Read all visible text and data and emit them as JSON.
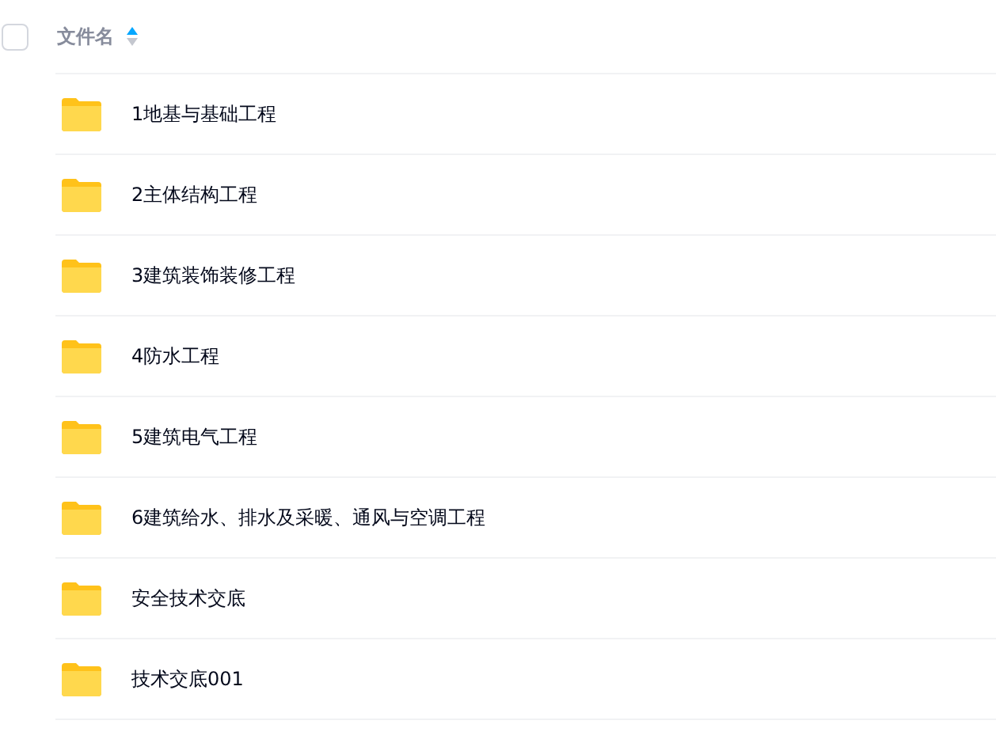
{
  "header": {
    "checked": false,
    "column": "文件名",
    "sort_ascending": true
  },
  "files": [
    {
      "name": "1地基与基础工程"
    },
    {
      "name": "2主体结构工程"
    },
    {
      "name": "3建筑装饰装修工程"
    },
    {
      "name": "4防水工程"
    },
    {
      "name": "5建筑电气工程"
    },
    {
      "name": "6建筑给水、排水及采暖、通风与空调工程"
    },
    {
      "name": "安全技术交底"
    },
    {
      "name": "技术交底001"
    }
  ]
}
